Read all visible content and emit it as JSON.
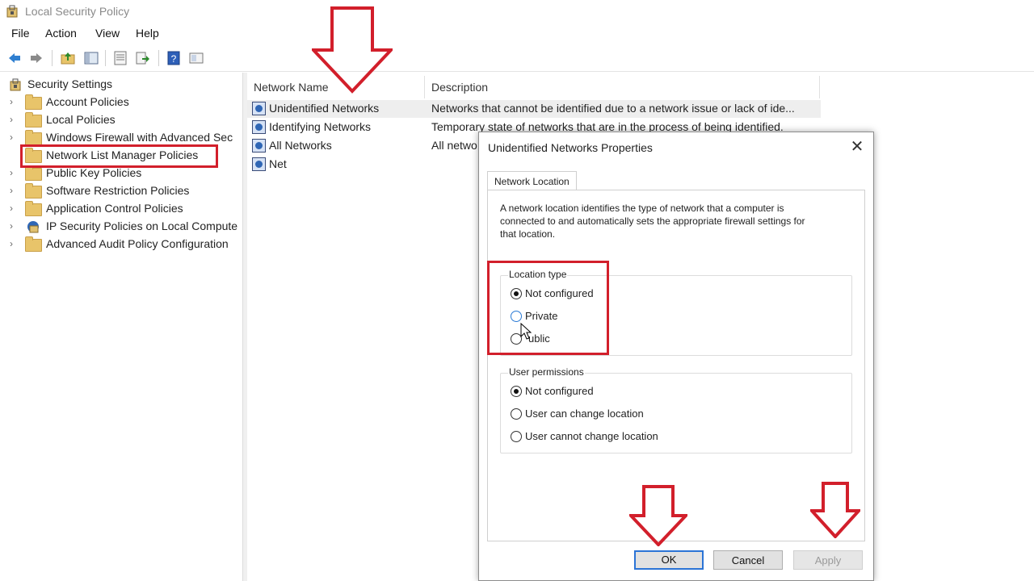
{
  "window": {
    "title": "Local Security Policy",
    "icon": "security-policy-icon"
  },
  "menu": [
    "File",
    "Action",
    "View",
    "Help"
  ],
  "toolbar": {
    "icons": [
      "back-arrow-icon",
      "forward-arrow-icon",
      "up-folder-icon",
      "show-hide-tree-icon",
      "properties-icon",
      "export-list-icon",
      "help-icon",
      "console-view-icon"
    ]
  },
  "tree": {
    "root": "Security Settings",
    "items": [
      {
        "label": "Account Policies"
      },
      {
        "label": "Local Policies"
      },
      {
        "label": "Windows Firewall with Advanced Sec"
      },
      {
        "label": "Network List Manager Policies",
        "highlighted": true
      },
      {
        "label": "Public Key Policies"
      },
      {
        "label": "Software Restriction Policies"
      },
      {
        "label": "Application Control Policies"
      },
      {
        "label": "IP Security Policies on Local Compute"
      },
      {
        "label": "Advanced Audit Policy Configuration"
      }
    ]
  },
  "list": {
    "columns": [
      "Network Name",
      "Description"
    ],
    "rows": [
      {
        "name": "Unidentified Networks",
        "description": "Networks that cannot be identified due to a network issue or lack of ide..."
      },
      {
        "name": "Identifying Networks",
        "description": "Temporary state of networks that are in the process of being identified."
      },
      {
        "name": "All Networks",
        "description": "All netwo"
      },
      {
        "name": "Net",
        "description": ""
      }
    ]
  },
  "dialog": {
    "title": "Unidentified Networks Properties",
    "close_glyph": "✕",
    "tab": "Network Location",
    "description_lines": [
      "A network location identifies the type of network that a computer is",
      "connected to and automatically sets the appropriate firewall settings for",
      "that location."
    ],
    "location_type": {
      "label": "Location type",
      "options": [
        "Not configured",
        "Private",
        "ublic"
      ],
      "selected": "Not configured"
    },
    "user_permissions": {
      "label": "User permissions",
      "options": [
        "Not configured",
        "User can change location",
        "User cannot change location"
      ],
      "selected": "Not configured"
    },
    "buttons": {
      "ok": "OK",
      "cancel": "Cancel",
      "apply": "Apply"
    }
  },
  "colors": {
    "annotation_red": "#d21f2b",
    "accent_blue": "#2b74d6",
    "folder": "#e8c46a"
  }
}
